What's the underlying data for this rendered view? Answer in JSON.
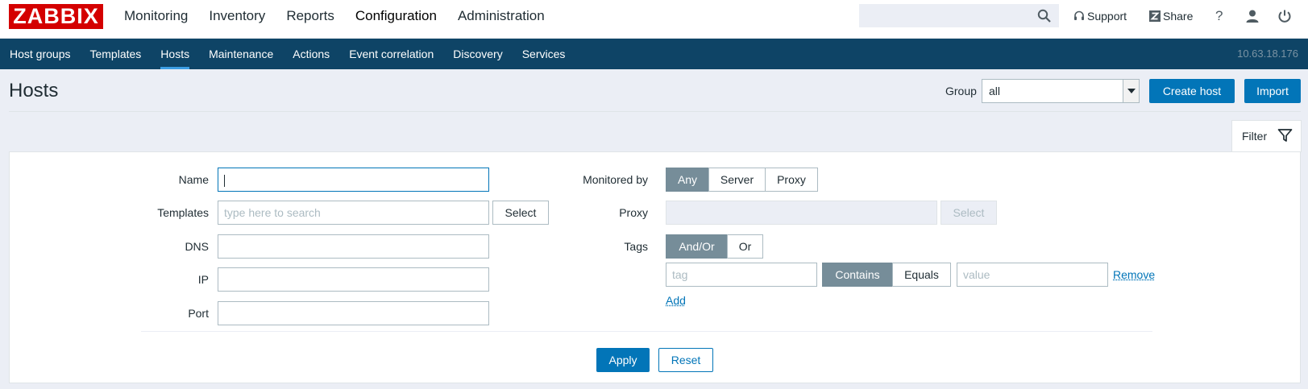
{
  "logo": "ZABBIX",
  "main_menu": [
    "Monitoring",
    "Inventory",
    "Reports",
    "Configuration",
    "Administration"
  ],
  "main_menu_active": "Configuration",
  "top_right": {
    "support": "Support",
    "share": "Share",
    "help": "?"
  },
  "sub_menu": [
    "Host groups",
    "Templates",
    "Hosts",
    "Maintenance",
    "Actions",
    "Event correlation",
    "Discovery",
    "Services"
  ],
  "sub_menu_active": "Hosts",
  "server_ip": "10.63.18.176",
  "page": {
    "title": "Hosts",
    "group_label": "Group",
    "group_value": "all",
    "create_host": "Create host",
    "import": "Import"
  },
  "filter": {
    "tab_label": "Filter",
    "name_label": "Name",
    "name_value": "",
    "templates_label": "Templates",
    "templates_placeholder": "type here to search",
    "select_label": "Select",
    "dns_label": "DNS",
    "ip_label": "IP",
    "port_label": "Port",
    "monitored_by_label": "Monitored by",
    "monitored_by_options": [
      "Any",
      "Server",
      "Proxy"
    ],
    "monitored_by_selected": "Any",
    "proxy_label": "Proxy",
    "tags_label": "Tags",
    "tags_operator_options": [
      "And/Or",
      "Or"
    ],
    "tags_operator_selected": "And/Or",
    "tag_placeholder": "tag",
    "tag_match_options": [
      "Contains",
      "Equals"
    ],
    "tag_match_selected": "Contains",
    "value_placeholder": "value",
    "remove_label": "Remove",
    "add_label": "Add",
    "apply_label": "Apply",
    "reset_label": "Reset"
  },
  "colors": {
    "brand_red": "#d40000",
    "nav_dark": "#0e4466",
    "primary": "#0275b8",
    "segment_selected": "#768d99"
  }
}
